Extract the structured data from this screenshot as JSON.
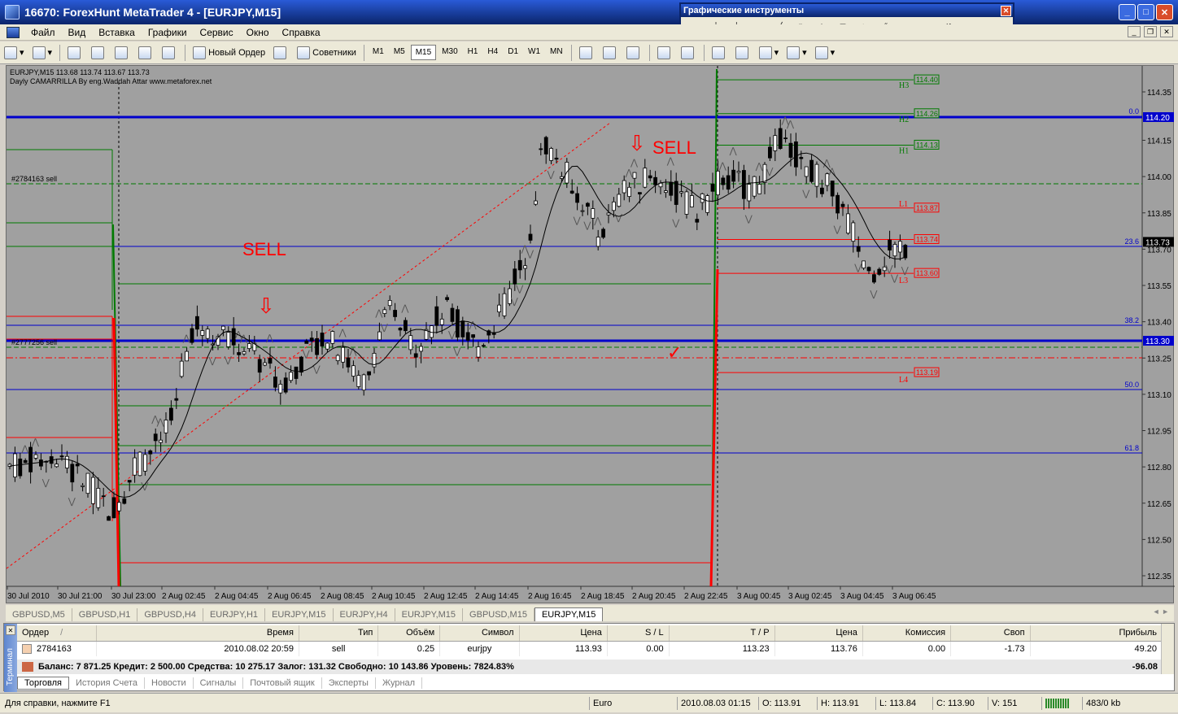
{
  "window": {
    "title": "16670: ForexHunt MetaTrader 4 - [EURJPY,M15]"
  },
  "menu": [
    "Файл",
    "Вид",
    "Вставка",
    "Графики",
    "Сервис",
    "Окно",
    "Справка"
  ],
  "toolbar": {
    "new_order": "Новый Ордер",
    "experts": "Советники",
    "timeframes": [
      "M1",
      "M5",
      "M15",
      "M30",
      "H1",
      "H4",
      "D1",
      "W1",
      "MN"
    ],
    "active_tf": "M15"
  },
  "graph_tools": {
    "title": "Графические инструменты",
    "tools": [
      "cursor-icon",
      "crosshair-icon",
      "vertical-line-icon",
      "horizontal-line-icon",
      "trendline-icon",
      "gann-icon",
      "text-icon",
      "label-icon",
      "fibo-icon",
      "channel-icon",
      "ellipse-icon",
      "rectangle-icon",
      "arrows-icon"
    ]
  },
  "chart": {
    "header_line1": "EURJPY,M15  113.68 113.74 113.67 113.73",
    "header_line2": "Dayly CAMARRILLA By eng.Waddah Attar www.metaforex.net",
    "order_label_1": "#2784163 sell",
    "order_label_2": "#2777256 sell",
    "sell_text": "SELL",
    "price_axis": [
      "114.35",
      "114.20",
      "114.15",
      "114.00",
      "113.85",
      "113.70",
      "113.55",
      "113.40",
      "113.30",
      "113.25",
      "113.10",
      "112.95",
      "112.80",
      "112.65",
      "112.50",
      "112.35"
    ],
    "price_labels": {
      "current": "113.73",
      "blue_top": "114.20",
      "blue_mid": "113.30"
    },
    "fibo": [
      "0.0",
      "23.6",
      "38.2",
      "50.0",
      "61.8"
    ],
    "camarilla": {
      "H3": "114.40",
      "H2": "114.26",
      "H1": "114.13",
      "L1": "113.87",
      "L2": "113.74",
      "L3": "113.60",
      "L4": "113.19"
    },
    "camarilla_names": {
      "H3": "H3",
      "H2": "H2",
      "H1": "H1",
      "L1": "L1",
      "L3": "L3",
      "L4": "L4"
    },
    "time_axis": [
      "30 Jul 2010",
      "30 Jul 21:00",
      "30 Jul 23:00",
      "2 Aug 02:45",
      "2 Aug 04:45",
      "2 Aug 06:45",
      "2 Aug 08:45",
      "2 Aug 10:45",
      "2 Aug 12:45",
      "2 Aug 14:45",
      "2 Aug 16:45",
      "2 Aug 18:45",
      "2 Aug 20:45",
      "2 Aug 22:45",
      "3 Aug 00:45",
      "3 Aug 02:45",
      "3 Aug 04:45",
      "3 Aug 06:45"
    ],
    "colors": {
      "bg": "#a0a0a0",
      "green": "#007a00",
      "red": "#ff0000",
      "blue": "#0000cc"
    }
  },
  "chart_tabs": [
    "GBPUSD,M5",
    "GBPUSD,H1",
    "GBPUSD,H4",
    "EURJPY,H1",
    "EURJPY,M15",
    "EURJPY,H4",
    "EURJPY,M15",
    "GBPUSD,M15",
    "EURJPY,M15"
  ],
  "active_chart_tab": 8,
  "terminal": {
    "side_label": "Терминал",
    "columns": [
      "Ордер",
      "Время",
      "Тип",
      "Объём",
      "Символ",
      "Цена",
      "S / L",
      "T / P",
      "Цена",
      "Комиссия",
      "Своп",
      "Прибыль"
    ],
    "order_sort_mark": "/",
    "rows": [
      [
        "2784163",
        "2010.08.02 20:59",
        "sell",
        "0.25",
        "eurjpy",
        "113.93",
        "0.00",
        "113.23",
        "113.76",
        "0.00",
        "-1.73",
        "49.20"
      ]
    ],
    "balance_text": "Баланс: 7 871.25  Кредит: 2 500.00  Средства: 10 275.17  Залог: 131.32  Свободно: 10 143.86  Уровень: 7824.83%",
    "balance_total": "-96.08",
    "tabs": [
      "Торговля",
      "История Счета",
      "Новости",
      "Сигналы",
      "Почтовый ящик",
      "Эксперты",
      "Журнал"
    ]
  },
  "status": {
    "help": "Для справки, нажмите F1",
    "profile": "Euro",
    "datetime": "2010.08.03 01:15",
    "open": "O: 113.91",
    "high": "H: 113.91",
    "low": "L: 113.84",
    "close": "C: 113.90",
    "volume": "V: 151",
    "traffic": "483/0 kb"
  }
}
